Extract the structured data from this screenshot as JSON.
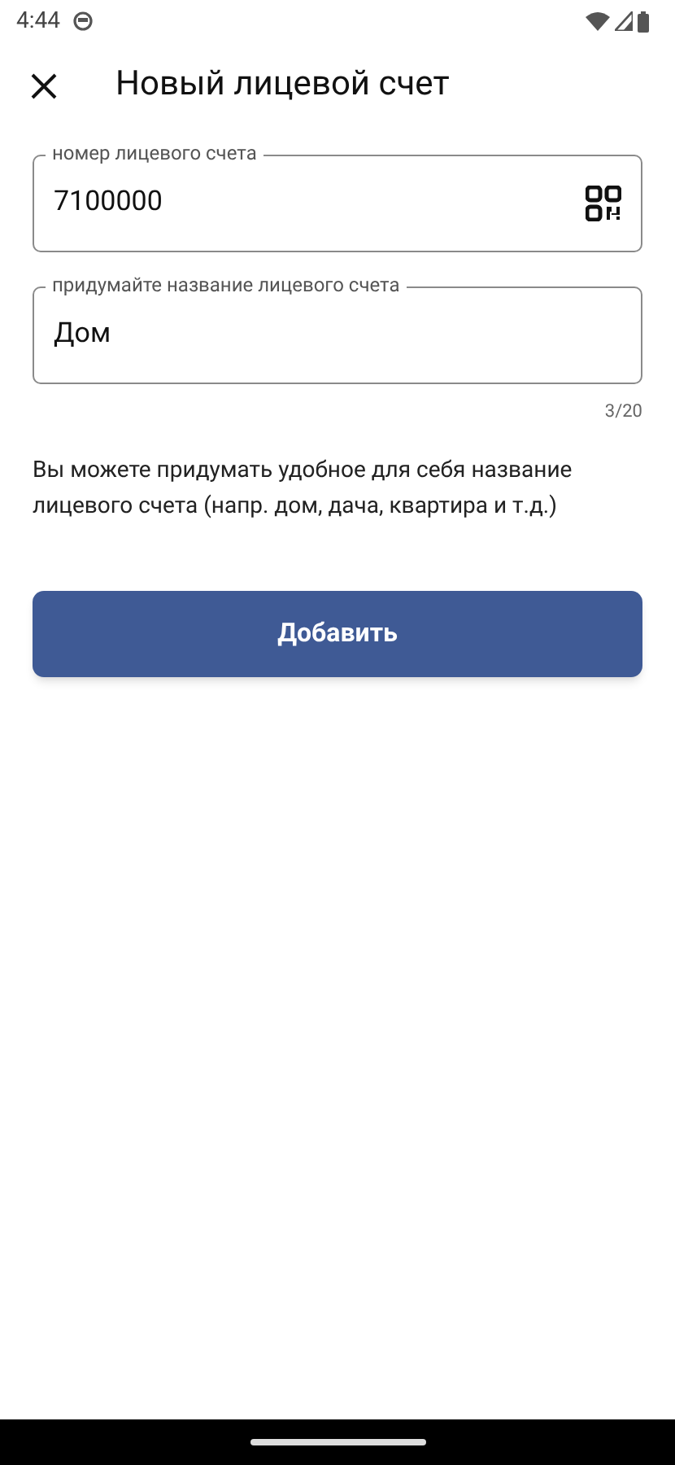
{
  "status_bar": {
    "time": "4:44"
  },
  "header": {
    "title": "Новый лицевой счет"
  },
  "fields": [
    {
      "label": "номер лицевого счета",
      "value": "7100000",
      "kind": "qr"
    },
    {
      "label": "придумайте название лицевого счета",
      "value": "Дом",
      "kind": "text",
      "counter": "3/20"
    }
  ],
  "hint": "Вы можете придумать удобное для себя название лицевого счета (напр. дом, дача, квартира и т.д.)",
  "button": {
    "label": "Добавить"
  }
}
